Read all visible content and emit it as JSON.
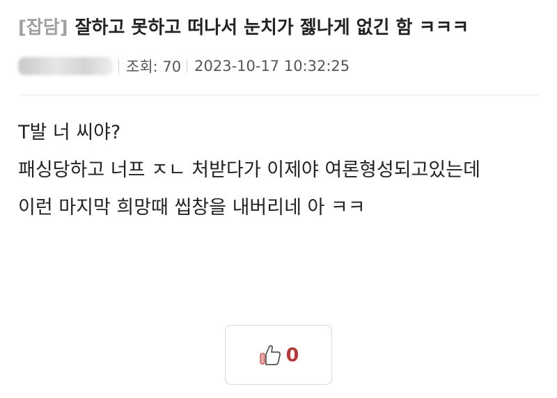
{
  "post": {
    "category": "[잡담]",
    "title": "잘하고 못하고 떠나서 눈치가 젫나게 없긴 함 ㅋㅋㅋ",
    "view_label": "조회: 70",
    "datetime": "2023-10-17 10:32:25",
    "content_lines": [
      "T발 너 씨야?",
      "패싱당하고 너프 ㅈㄴ 처받다가 이제야 여론형성되고있는데",
      "이런 마지막 희망때 씹창을 내버리네 아 ㅋㅋ"
    ]
  },
  "like": {
    "count": "0",
    "icon": "thumbs-up-icon",
    "accent_color": "#b23a3a"
  }
}
